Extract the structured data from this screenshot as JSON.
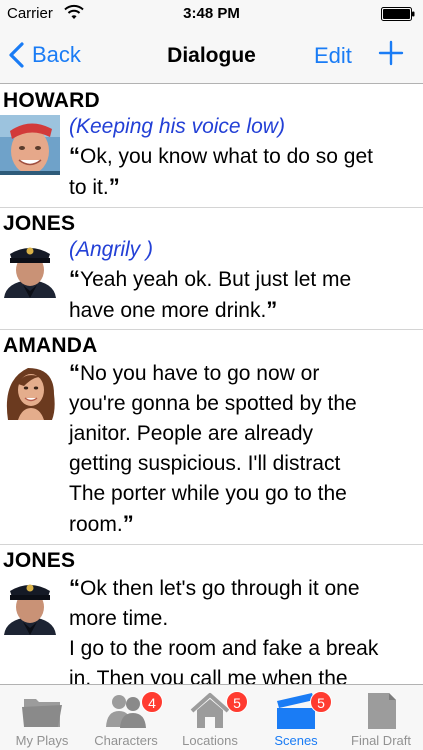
{
  "status_bar": {
    "carrier": "Carrier",
    "time": "3:48 PM"
  },
  "nav": {
    "back_label": "Back",
    "title": "Dialogue",
    "edit_label": "Edit"
  },
  "dialogues": [
    {
      "character": "HOWARD",
      "parenthetical": "(Keeping his voice low)",
      "line1": "Ok, you know what to do so get",
      "line2": "to it."
    },
    {
      "character": "JONES",
      "parenthetical": "(Angrily )",
      "line1": "Yeah yeah ok. But just let me",
      "line2": "have one more drink."
    },
    {
      "character": "AMANDA",
      "line1": "No you have to go now or",
      "line2": "you're gonna be spotted by the",
      "line3": "janitor. People are already",
      "line4": "getting suspicious. I'll distract",
      "line5": "The porter while you go to the",
      "line6": "room."
    },
    {
      "character": "JONES",
      "line1": "Ok then let's go through it one",
      "line2": "more time.",
      "line3": "I go to the room and fake a break",
      "line4": "in. Then you call me when the"
    }
  ],
  "tabs": [
    {
      "label": "My Plays",
      "icon": "folder-icon"
    },
    {
      "label": "Characters",
      "icon": "people-icon",
      "badge": "4"
    },
    {
      "label": "Locations",
      "icon": "house-icon",
      "badge": "5"
    },
    {
      "label": "Scenes",
      "icon": "clapperboard-icon",
      "badge": "5",
      "selected": true
    },
    {
      "label": "Final Draft",
      "icon": "document-icon"
    }
  ],
  "colors": {
    "accent": "#1a7cf5",
    "parenthetical": "#2340d6",
    "badge": "#ff3b30",
    "tab_inactive": "#929292"
  }
}
